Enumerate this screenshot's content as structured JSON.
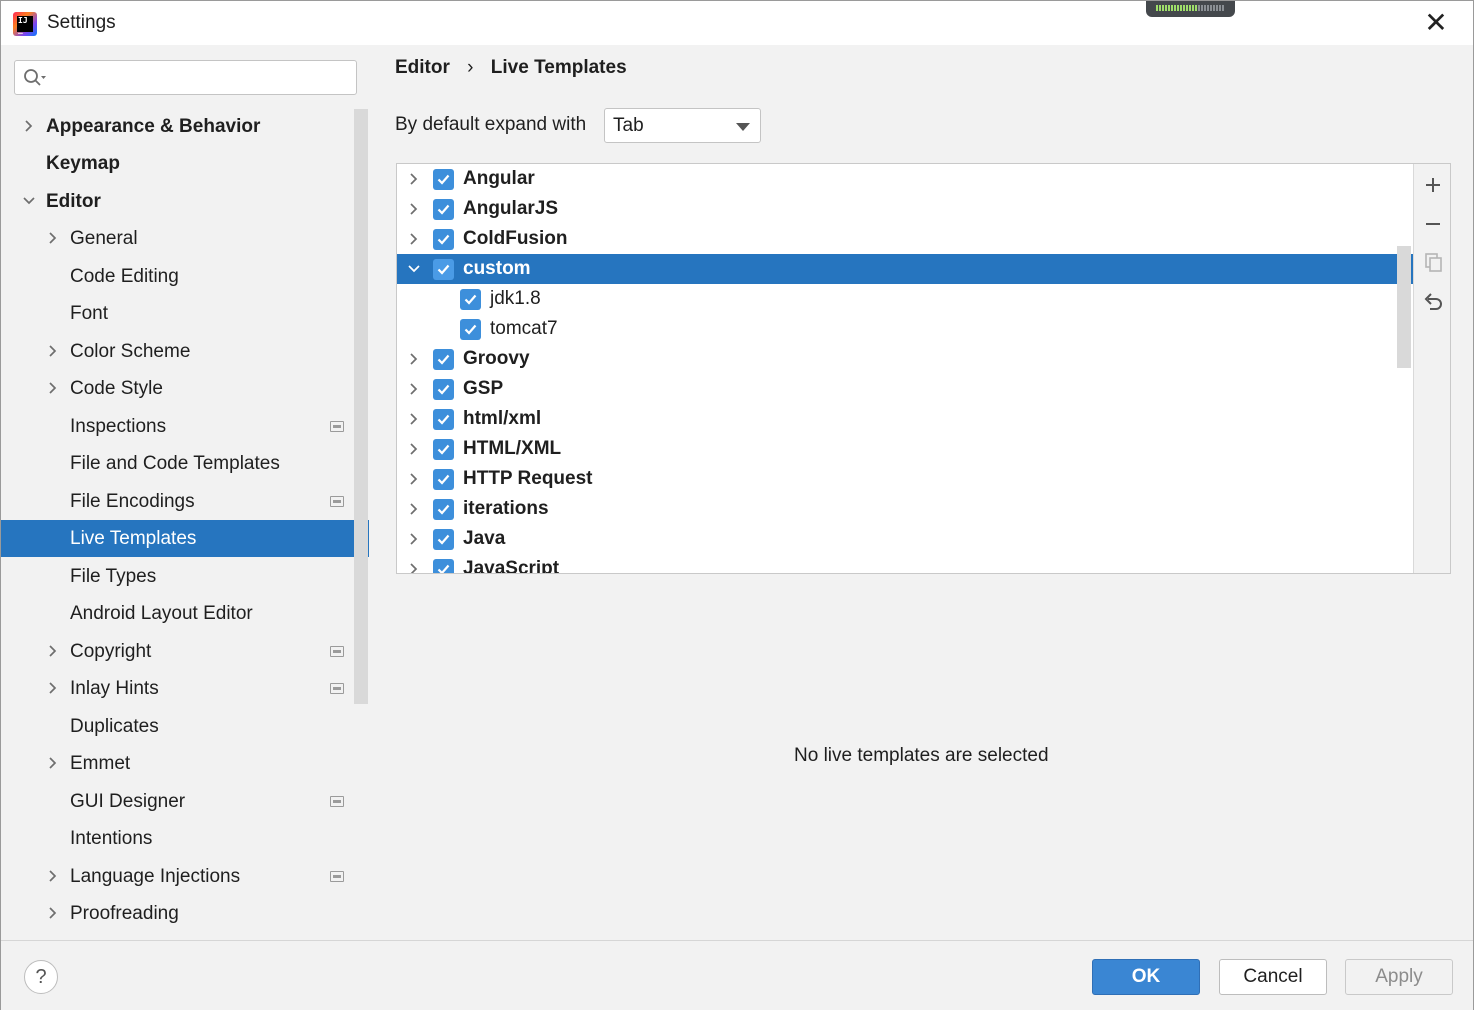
{
  "window": {
    "title": "Settings"
  },
  "search": {
    "placeholder": "",
    "value": ""
  },
  "sidebar": {
    "items": [
      {
        "label": "Appearance & Behavior",
        "bold": true,
        "arrow": "right",
        "project": false
      },
      {
        "label": "Keymap",
        "bold": true,
        "arrow": "",
        "project": false
      },
      {
        "label": "Editor",
        "bold": true,
        "arrow": "down",
        "project": false
      },
      {
        "label": "General",
        "arrow": "right",
        "project": false
      },
      {
        "label": "Code Editing",
        "arrow": "",
        "project": false
      },
      {
        "label": "Font",
        "arrow": "",
        "project": false
      },
      {
        "label": "Color Scheme",
        "arrow": "right",
        "project": false
      },
      {
        "label": "Code Style",
        "arrow": "right",
        "project": false
      },
      {
        "label": "Inspections",
        "arrow": "",
        "project": true
      },
      {
        "label": "File and Code Templates",
        "arrow": "",
        "project": false
      },
      {
        "label": "File Encodings",
        "arrow": "",
        "project": true
      },
      {
        "label": "Live Templates",
        "arrow": "",
        "project": false,
        "selected": true
      },
      {
        "label": "File Types",
        "arrow": "",
        "project": false
      },
      {
        "label": "Android Layout Editor",
        "arrow": "",
        "project": false
      },
      {
        "label": "Copyright",
        "arrow": "right",
        "project": true
      },
      {
        "label": "Inlay Hints",
        "arrow": "right",
        "project": true
      },
      {
        "label": "Duplicates",
        "arrow": "",
        "project": false
      },
      {
        "label": "Emmet",
        "arrow": "right",
        "project": false
      },
      {
        "label": "GUI Designer",
        "arrow": "",
        "project": true
      },
      {
        "label": "Intentions",
        "arrow": "",
        "project": false
      },
      {
        "label": "Language Injections",
        "arrow": "right",
        "project": true
      },
      {
        "label": "Proofreading",
        "arrow": "right",
        "project": false
      }
    ]
  },
  "breadcrumb": {
    "parent": "Editor",
    "separator": "›",
    "current": "Live Templates"
  },
  "expand": {
    "label": "By default expand with",
    "value": "Tab"
  },
  "templates": [
    {
      "name": "Angular",
      "checked": true,
      "arrow": "right",
      "level": 0
    },
    {
      "name": "AngularJS",
      "checked": true,
      "arrow": "right",
      "level": 0
    },
    {
      "name": "ColdFusion",
      "checked": true,
      "arrow": "right",
      "level": 0
    },
    {
      "name": "custom",
      "checked": true,
      "arrow": "down",
      "level": 0,
      "selected": true
    },
    {
      "name": "jdk1.8",
      "checked": true,
      "arrow": "",
      "level": 1
    },
    {
      "name": "tomcat7",
      "checked": true,
      "arrow": "",
      "level": 1
    },
    {
      "name": "Groovy",
      "checked": true,
      "arrow": "right",
      "level": 0
    },
    {
      "name": "GSP",
      "checked": true,
      "arrow": "right",
      "level": 0
    },
    {
      "name": "html/xml",
      "checked": true,
      "arrow": "right",
      "level": 0
    },
    {
      "name": "HTML/XML",
      "checked": true,
      "arrow": "right",
      "level": 0
    },
    {
      "name": "HTTP Request",
      "checked": true,
      "arrow": "right",
      "level": 0
    },
    {
      "name": "iterations",
      "checked": true,
      "arrow": "right",
      "level": 0
    },
    {
      "name": "Java",
      "checked": true,
      "arrow": "right",
      "level": 0
    },
    {
      "name": "JavaScript",
      "checked": true,
      "arrow": "right",
      "level": 0
    }
  ],
  "toolbar": {
    "icons": [
      "plus-icon",
      "minus-icon",
      "copy-icon",
      "undo-icon"
    ]
  },
  "empty_message": "No live templates are selected",
  "buttons": {
    "help": "?",
    "ok": "OK",
    "cancel": "Cancel",
    "apply": "Apply"
  },
  "colors": {
    "accent": "#2675bf",
    "checkbox": "#3d8fdb",
    "ok_button": "#3a86d3"
  }
}
